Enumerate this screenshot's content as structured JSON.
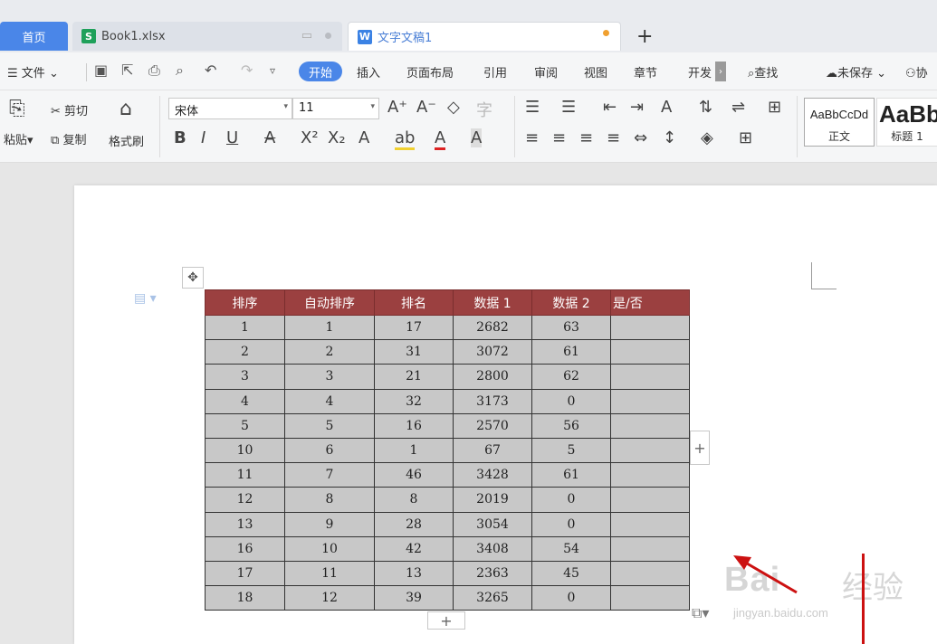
{
  "tabs": {
    "home": "首页",
    "excel": "Book1.xlsx",
    "doc": "文字文稿1",
    "add": "+"
  },
  "menu": {
    "file": "文件",
    "items": [
      "开始",
      "插入",
      "页面布局",
      "引用",
      "审阅",
      "视图",
      "章节",
      "开发"
    ],
    "search": "查找",
    "unsaved": "未保存",
    "collab": "协"
  },
  "ribbon": {
    "paste": "粘贴",
    "cut": "剪切",
    "copy": "复制",
    "format_painter": "格式刷",
    "font_name": "宋体",
    "font_size": "11",
    "style_normal_preview": "AaBbCcDd",
    "style_normal_label": "正文",
    "style_heading_preview": "AaBb",
    "style_heading_label": "标题 1"
  },
  "table": {
    "headers": [
      "排序",
      "自动排序",
      "排名",
      "数据 1",
      "数据 2",
      "是/否"
    ],
    "rows": [
      [
        "1",
        "1",
        "17",
        "2682",
        "63",
        ""
      ],
      [
        "2",
        "2",
        "31",
        "3072",
        "61",
        ""
      ],
      [
        "3",
        "3",
        "21",
        "2800",
        "62",
        ""
      ],
      [
        "4",
        "4",
        "32",
        "3173",
        "0",
        ""
      ],
      [
        "5",
        "5",
        "16",
        "2570",
        "56",
        ""
      ],
      [
        "10",
        "6",
        "1",
        "67",
        "5",
        ""
      ],
      [
        "11",
        "7",
        "46",
        "3428",
        "61",
        ""
      ],
      [
        "12",
        "8",
        "8",
        "2019",
        "0",
        ""
      ],
      [
        "13",
        "9",
        "28",
        "3054",
        "0",
        ""
      ],
      [
        "16",
        "10",
        "42",
        "3408",
        "54",
        ""
      ],
      [
        "17",
        "11",
        "13",
        "2363",
        "45",
        ""
      ],
      [
        "18",
        "12",
        "39",
        "3265",
        "0",
        ""
      ]
    ]
  },
  "watermark": {
    "brand": "Bai",
    "brand_cn": "经验",
    "url": "jingyan.baidu.com"
  },
  "colors": {
    "accent": "#4a86e8",
    "header_bg": "#9b4040",
    "cell_bg": "#c8c8c8",
    "annotation": "#cc1111"
  }
}
